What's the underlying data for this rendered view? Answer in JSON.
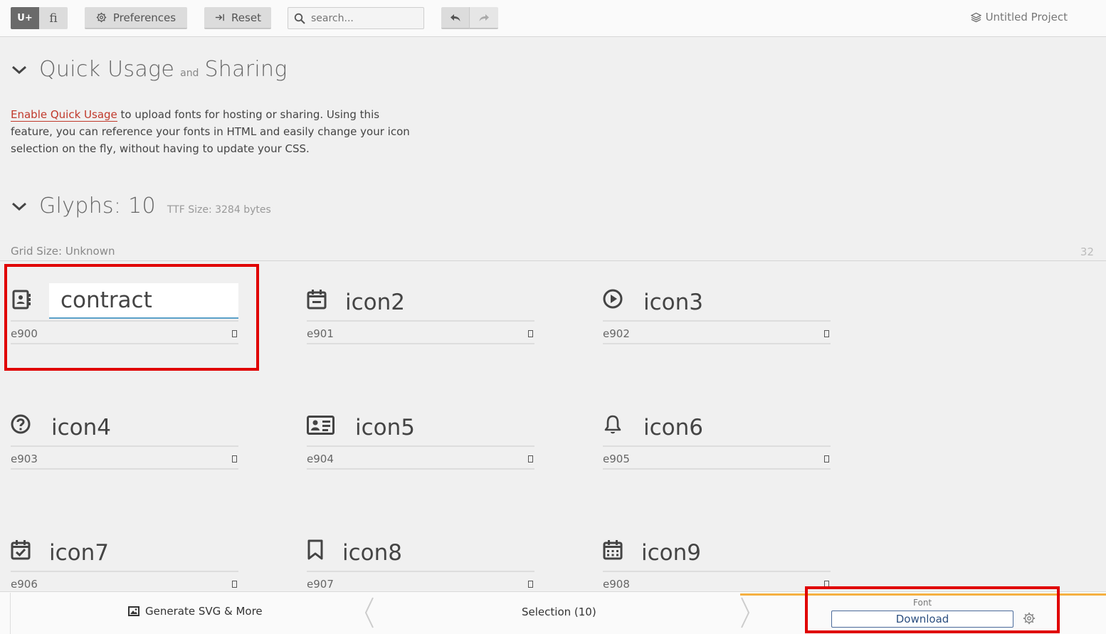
{
  "toolbar": {
    "mode_unicode": "U+",
    "mode_ligature": "fi",
    "preferences_label": "Preferences",
    "reset_label": "Reset",
    "search_placeholder": "search...",
    "project_name": "Untitled Project"
  },
  "quick_usage": {
    "title_part1": "Quick Usage",
    "title_and": "and",
    "title_part2": "Sharing",
    "link_text": "Enable Quick Usage",
    "description": " to upload fonts for hosting or sharing. Using this feature, you can reference your fonts in HTML and easily change your icon selection on the fly, without having to update your CSS."
  },
  "glyphs_section": {
    "title": "Glyphs: 10",
    "ttf_size": "TTF Size: 3284 bytes",
    "grid_size": "Grid Size: Unknown",
    "grid_number": "32"
  },
  "glyphs": [
    {
      "name": "contract",
      "code": "e900",
      "icon": "contact-book-icon"
    },
    {
      "name": "icon2",
      "code": "e901",
      "icon": "calendar-minus-icon"
    },
    {
      "name": "icon3",
      "code": "e902",
      "icon": "play-circle-icon"
    },
    {
      "name": "icon4",
      "code": "e903",
      "icon": "help-circle-icon"
    },
    {
      "name": "icon5",
      "code": "e904",
      "icon": "id-card-icon"
    },
    {
      "name": "icon6",
      "code": "e905",
      "icon": "bell-icon"
    },
    {
      "name": "icon7",
      "code": "e906",
      "icon": "calendar-check-icon"
    },
    {
      "name": "icon8",
      "code": "e907",
      "icon": "bookmark-icon"
    },
    {
      "name": "icon9",
      "code": "e908",
      "icon": "calendar-grid-icon"
    }
  ],
  "bottombar": {
    "generate_label": "Generate SVG & More",
    "selection_label": "Selection (10)",
    "font_label": "Font",
    "download_label": "Download"
  },
  "colors": {
    "link_red": "#c0392b",
    "highlight_red": "#e00000",
    "accent_orange": "#f5b041",
    "input_underline": "#5aa0c8"
  }
}
